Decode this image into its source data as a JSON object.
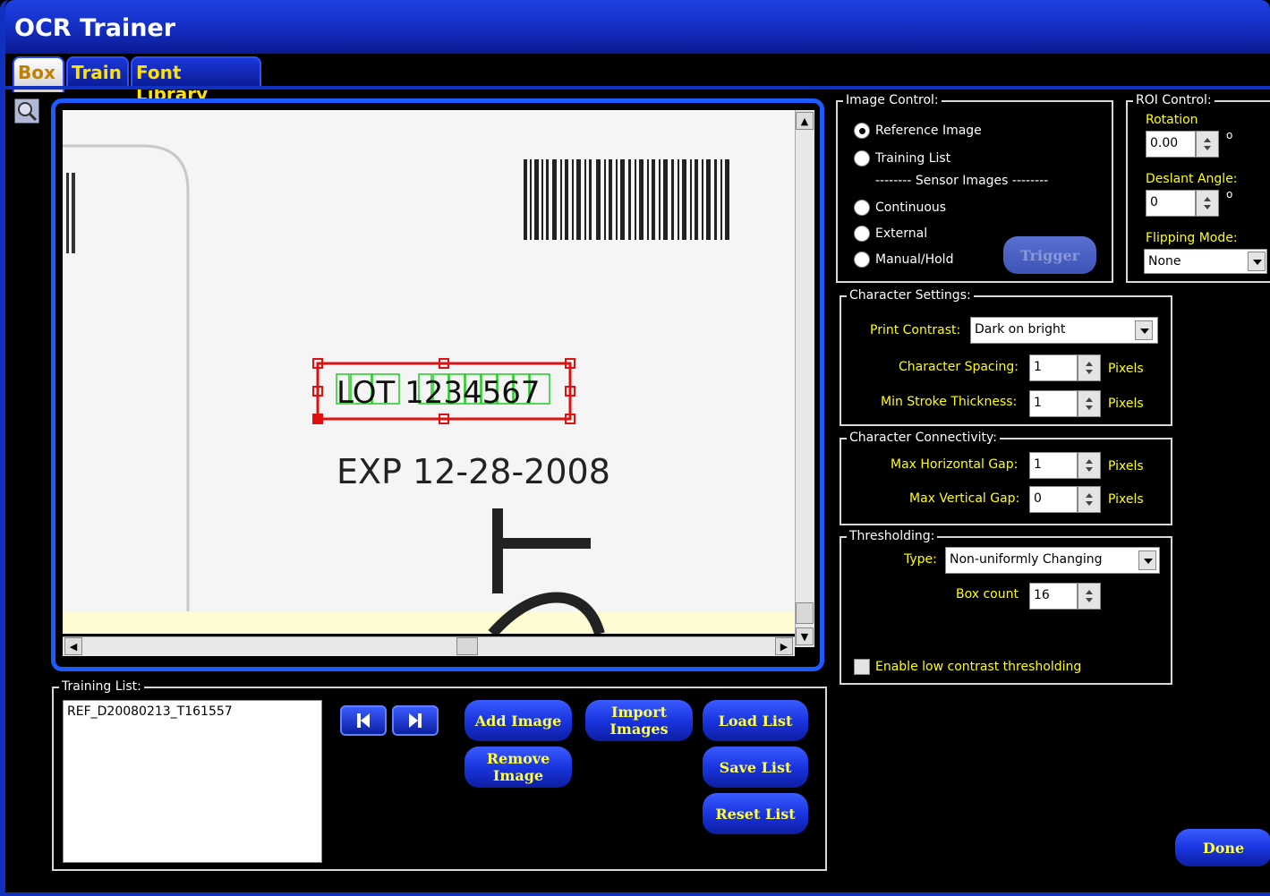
{
  "window": {
    "title": "OCR Trainer"
  },
  "tabs": [
    {
      "label": "Box",
      "active": true
    },
    {
      "label": "Train",
      "active": false
    },
    {
      "label": "Font Library",
      "active": false
    }
  ],
  "image": {
    "label_text": "LOT 1234567",
    "exp_text": "EXP 12-28-2008"
  },
  "image_control": {
    "legend": "Image Control:",
    "options": [
      "Reference Image",
      "Training List",
      "Continuous",
      "External",
      "Manual/Hold"
    ],
    "selected": "Reference Image",
    "separator": "-------- Sensor Images --------",
    "trigger_label": "Trigger"
  },
  "roi_control": {
    "legend": "ROI Control:",
    "rotation_label": "Rotation",
    "rotation_value": "0.00",
    "deslant_label": "Deslant Angle:",
    "deslant_value": "0",
    "degree_symbol": "o",
    "flipping_label": "Flipping Mode:",
    "flipping_value": "None"
  },
  "character_settings": {
    "legend": "Character Settings:",
    "print_contrast_label": "Print Contrast:",
    "print_contrast_value": "Dark on bright",
    "spacing_label": "Character Spacing:",
    "spacing_value": "1",
    "stroke_label": "Min Stroke Thickness:",
    "stroke_value": "1",
    "units": "Pixels"
  },
  "character_connectivity": {
    "legend": "Character Connectivity:",
    "hgap_label": "Max Horizontal Gap:",
    "hgap_value": "1",
    "vgap_label": "Max Vertical Gap:",
    "vgap_value": "0",
    "units": "Pixels"
  },
  "thresholding": {
    "legend": "Thresholding:",
    "type_label": "Type:",
    "type_value": "Non-uniformly Changing",
    "box_count_label": "Box count",
    "box_count_value": "16",
    "low_contrast_label": "Enable low contrast thresholding",
    "low_contrast_checked": false
  },
  "training_list": {
    "legend": "Training List:",
    "items": [
      "REF_D20080213_T161557"
    ],
    "add_image": "Add Image",
    "remove_image": "Remove Image",
    "import_images": "Import Images",
    "load_list": "Load List",
    "save_list": "Save List",
    "reset_list": "Reset List"
  },
  "done_label": "Done",
  "colors": {
    "accent": "#1030c0",
    "button_text": "#ffff40",
    "box_red": "#e01010",
    "char_green": "#22cc22"
  }
}
